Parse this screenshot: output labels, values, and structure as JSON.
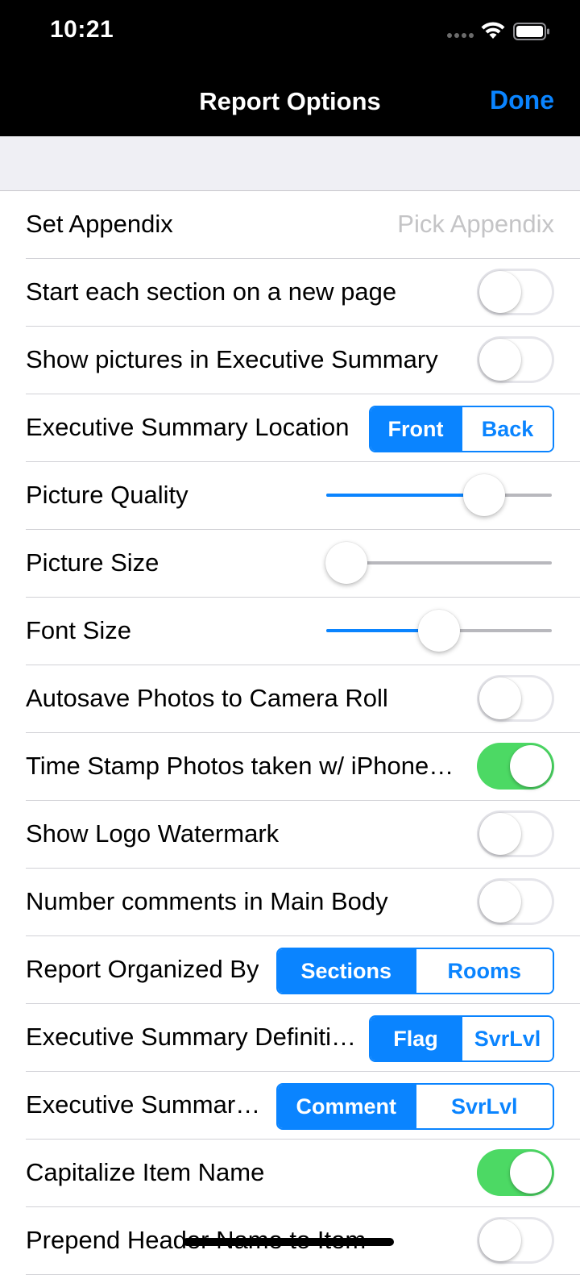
{
  "status_bar": {
    "time": "10:21",
    "icons": [
      "cellular-signal-icon",
      "wifi-icon",
      "battery-icon"
    ]
  },
  "nav": {
    "title": "Report Options",
    "done_label": "Done"
  },
  "colors": {
    "accent": "#0a84ff",
    "toggle_on": "#4cd964",
    "placeholder": "#c4c4c6"
  },
  "rows": [
    {
      "id": "set-appendix",
      "type": "disclosure",
      "label": "Set Appendix",
      "value": "Pick Appendix"
    },
    {
      "id": "start-section-new-page",
      "type": "toggle",
      "label": "Start each section on a new page",
      "on": false
    },
    {
      "id": "show-pictures-exec-summary",
      "type": "toggle",
      "label": "Show pictures in Executive Summary",
      "on": false
    },
    {
      "id": "exec-summary-location",
      "type": "segmented",
      "label": "Executive Summary Location",
      "options": [
        "Front",
        "Back"
      ],
      "selected": 0,
      "width": 230
    },
    {
      "id": "picture-quality",
      "type": "slider",
      "label": "Picture Quality",
      "value": 0.7
    },
    {
      "id": "picture-size",
      "type": "slider",
      "label": "Picture Size",
      "value": 0.09
    },
    {
      "id": "font-size",
      "type": "slider",
      "label": "Font Size",
      "value": 0.5
    },
    {
      "id": "autosave-camera-roll",
      "type": "toggle",
      "label": "Autosave Photos to Camera Roll",
      "on": false
    },
    {
      "id": "time-stamp-photos",
      "type": "toggle",
      "label": "Time Stamp Photos taken w/ iPhone…",
      "on": true
    },
    {
      "id": "show-logo-watermark",
      "type": "toggle",
      "label": "Show Logo Watermark",
      "on": false
    },
    {
      "id": "number-comments-main-body",
      "type": "toggle",
      "label": "Number comments in Main Body",
      "on": false
    },
    {
      "id": "report-organized-by",
      "type": "segmented",
      "label": "Report Organized By",
      "options": [
        "Sections",
        "Rooms"
      ],
      "selected": 0,
      "width": 345
    },
    {
      "id": "exec-summary-definition",
      "type": "segmented",
      "label": "Executive Summary Definiti…",
      "options": [
        "Flag",
        "SvrLvl"
      ],
      "selected": 0,
      "width": 230
    },
    {
      "id": "exec-summary-other",
      "type": "segmented",
      "label": "Executive Summar…",
      "options": [
        "Comment",
        "SvrLvl"
      ],
      "selected": 0,
      "width": 345
    },
    {
      "id": "capitalize-item-name",
      "type": "toggle",
      "label": "Capitalize Item Name",
      "on": true
    },
    {
      "id": "prepend-header-name",
      "type": "toggle",
      "label": "Prepend Header Name to Item",
      "on": false
    }
  ]
}
